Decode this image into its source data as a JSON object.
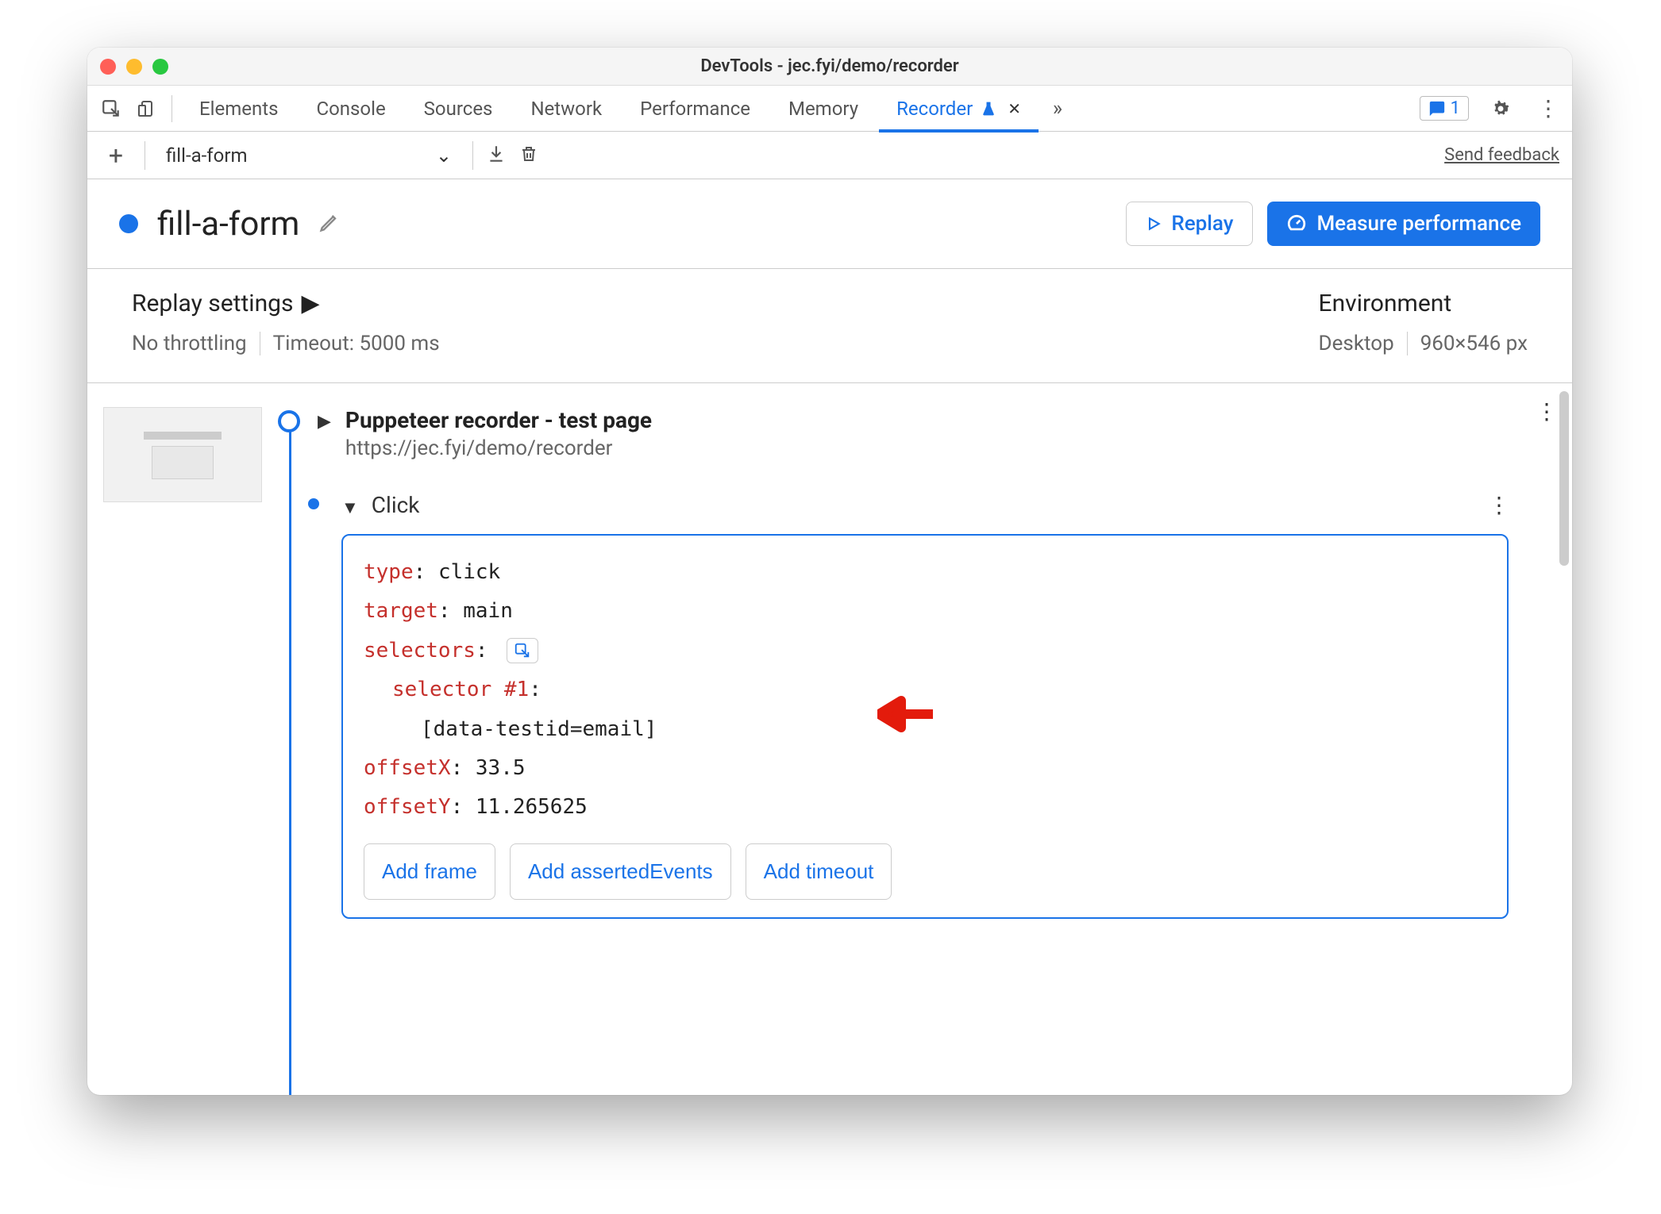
{
  "window": {
    "title": "DevTools - jec.fyi/demo/recorder"
  },
  "tabs": {
    "items": [
      "Elements",
      "Console",
      "Sources",
      "Network",
      "Performance",
      "Memory",
      "Recorder"
    ],
    "active": "Recorder",
    "feedback_count": "1"
  },
  "toolbar": {
    "recording_name": "fill-a-form",
    "send_feedback": "Send feedback"
  },
  "header": {
    "title": "fill-a-form",
    "replay_btn": "Replay",
    "measure_btn": "Measure performance"
  },
  "settings": {
    "replay_title": "Replay settings",
    "throttling": "No throttling",
    "timeout": "Timeout: 5000 ms",
    "env_title": "Environment",
    "device": "Desktop",
    "viewport": "960×546 px"
  },
  "steps": {
    "root_title": "Puppeteer recorder - test page",
    "root_url": "https://jec.fyi/demo/recorder",
    "click": {
      "label": "Click",
      "type_key": "type",
      "type_val": "click",
      "target_key": "target",
      "target_val": "main",
      "selectors_key": "selectors",
      "selector_num_key": "selector #1",
      "selector_val": "[data-testid=email]",
      "offsetX_key": "offsetX",
      "offsetX_val": "33.5",
      "offsetY_key": "offsetY",
      "offsetY_val": "11.265625",
      "add_frame": "Add frame",
      "add_asserted": "Add assertedEvents",
      "add_timeout": "Add timeout"
    }
  }
}
